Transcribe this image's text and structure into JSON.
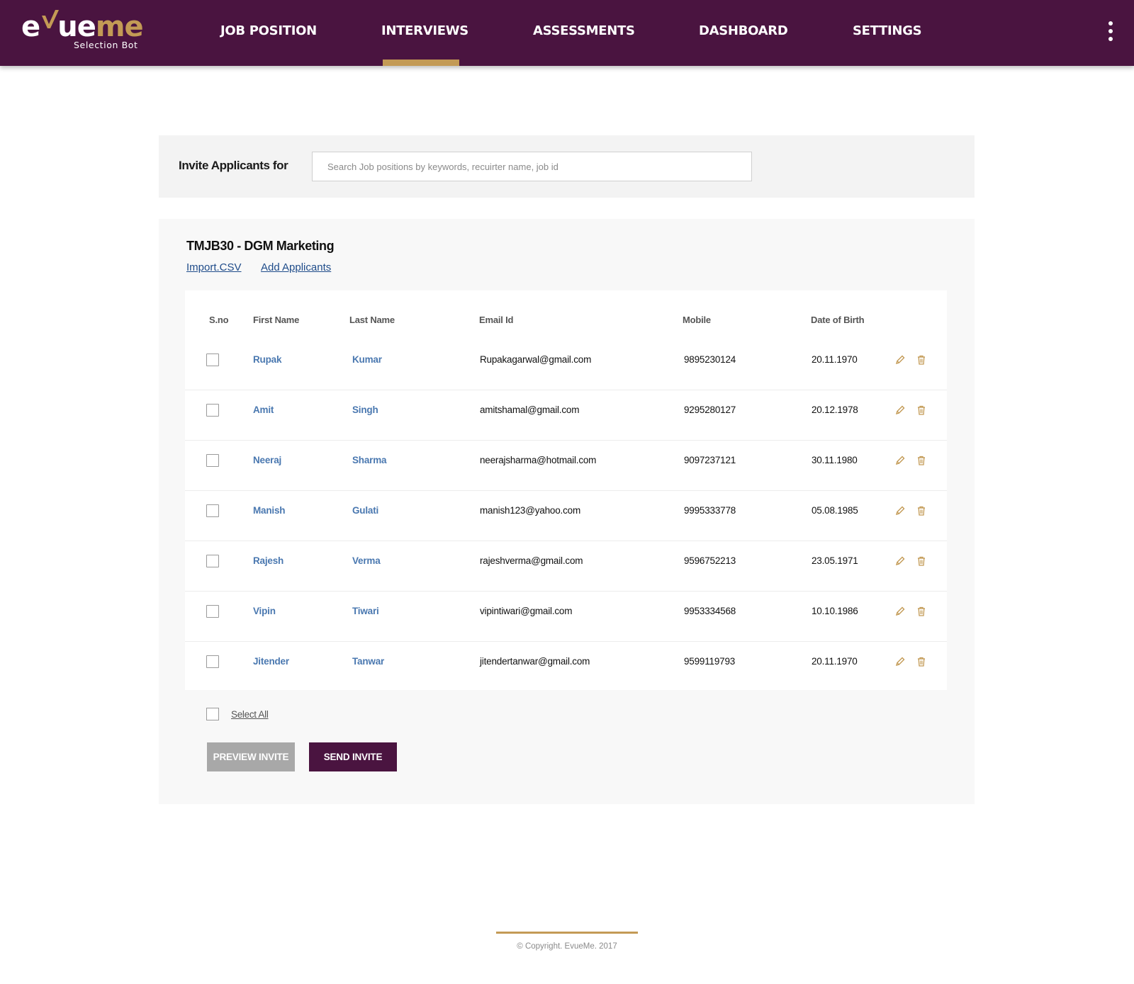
{
  "app": {
    "logo_main": "evueme",
    "logo_sub": "Selection Bot"
  },
  "nav": {
    "items": [
      {
        "label": "JOB POSITION"
      },
      {
        "label": "INTERVIEWS",
        "active": true
      },
      {
        "label": "ASSESSMENTS"
      },
      {
        "label": "DASHBOARD"
      },
      {
        "label": "SETTINGS"
      }
    ]
  },
  "invite": {
    "label": "Invite Applicants for",
    "search_placeholder": "Search Job positions by keywords, recuirter name, job id",
    "search_value": ""
  },
  "job": {
    "title": "TMJB30 - DGM Marketing",
    "import_link": "Import.CSV",
    "add_link": "Add Applicants"
  },
  "table": {
    "headers": {
      "sno": "S.no",
      "first_name": "First Name",
      "last_name": "Last Name",
      "email": "Email Id",
      "mobile": "Mobile",
      "dob": "Date of Birth"
    },
    "rows": [
      {
        "first": "Rupak",
        "last": "Kumar",
        "email": "Rupakagarwal@gmail.com",
        "mobile": "9895230124",
        "dob": "20.11.1970",
        "checked": false
      },
      {
        "first": "Amit",
        "last": "Singh",
        "email": "amitshamal@gmail.com",
        "mobile": "9295280127",
        "dob": "20.12.1978",
        "checked": false
      },
      {
        "first": "Neeraj",
        "last": "Sharma",
        "email": "neerajsharma@hotmail.com",
        "mobile": "9097237121",
        "dob": "30.11.1980",
        "checked": false
      },
      {
        "first": "Manish",
        "last": "Gulati",
        "email": "manish123@yahoo.com",
        "mobile": "9995333778",
        "dob": "05.08.1985",
        "checked": false
      },
      {
        "first": "Rajesh",
        "last": "Verma",
        "email": "rajeshverma@gmail.com",
        "mobile": "9596752213",
        "dob": "23.05.1971",
        "checked": false
      },
      {
        "first": "Vipin",
        "last": "Tiwari",
        "email": "vipintiwari@gmail.com",
        "mobile": "9953334568",
        "dob": "10.10.1986",
        "checked": false
      },
      {
        "first": "Jitender",
        "last": "Tanwar",
        "email": "jitendertanwar@gmail.com",
        "mobile": "9599119793",
        "dob": "20.11.1970",
        "checked": false
      }
    ],
    "row_icons": [
      "pencil-icon",
      "trash-icon"
    ]
  },
  "actions": {
    "select_all": "Select All",
    "preview_label": "PREVIEW INVITE",
    "send_label": "SEND INVITE"
  },
  "footer": {
    "copyright": "© Copyright. EvueMe. 2017"
  },
  "colors": {
    "brand_purple": "#4a1440",
    "brand_gold": "#c39a55",
    "name_link_blue": "#4a78b0",
    "link_blue": "#1f4c8a",
    "preview_grey": "#a8a8a8"
  }
}
